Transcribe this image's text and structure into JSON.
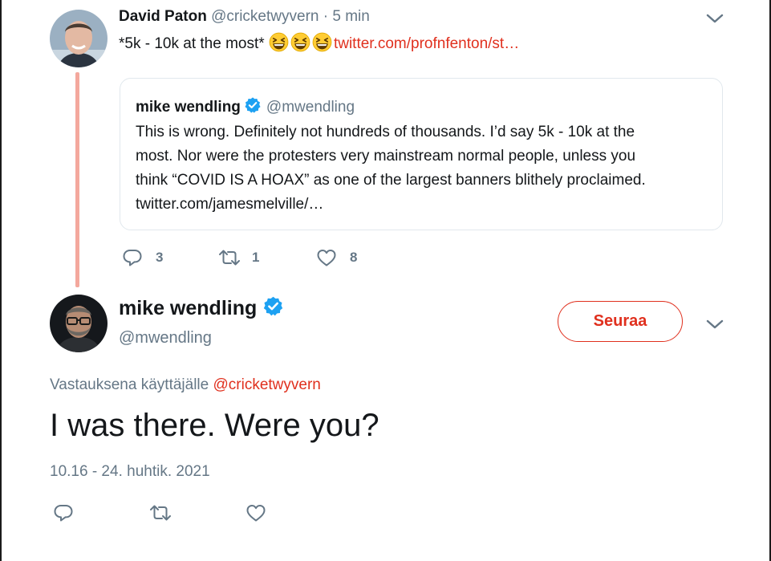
{
  "parent_tweet": {
    "author_name": "David Paton",
    "author_handle": "@cricketwyvern",
    "dot": "·",
    "time": "5 min",
    "text": "*5k - 10k at the most*",
    "emoji_icon": "grinning-squinting-face-icon",
    "emoji_count": 3,
    "link": "twitter.com/profnfenton/st…",
    "quoted": {
      "author_name": "mike wendling",
      "author_handle": "@mwendling",
      "verified": true,
      "lines": [
        "This is wrong. Definitely not hundreds of thousands. I’d say 5k - 10k at the",
        "most. Nor were the protesters very mainstream normal people, unless you",
        "think “COVID IS A HOAX” as one of the largest banners blithely proclaimed.",
        "twitter.com/jamesmelville/…"
      ]
    },
    "actions": {
      "reply_count": "3",
      "retweet_count": "1",
      "like_count": "8"
    }
  },
  "main_tweet": {
    "author_name": "mike wendling",
    "author_handle": "@mwendling",
    "verified": true,
    "follow_label": "Seuraa",
    "reply_prefix": "Vastauksena käyttäjälle",
    "reply_mention": "@cricketwyvern",
    "text": "I was there. Were you?",
    "timestamp": "10.16 - 24. huhtik. 2021"
  },
  "colors": {
    "accent": "#e0301e",
    "secondary_text": "#657786",
    "verified": "#1da1f2",
    "thread_line": "#f4a89d"
  }
}
